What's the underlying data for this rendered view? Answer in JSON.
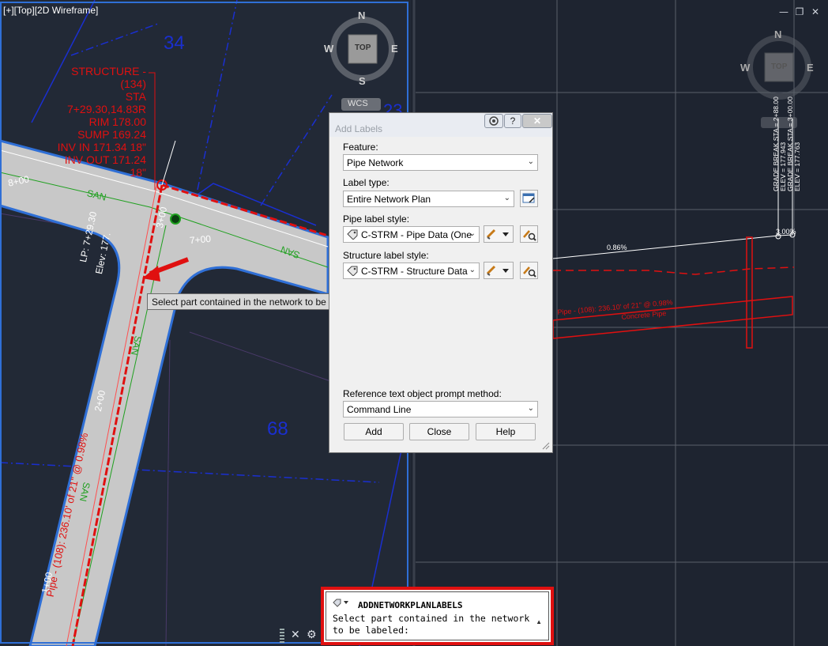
{
  "viewport": {
    "label": "[+][Top][2D Wireframe]"
  },
  "viewcube": {
    "left": {
      "n": "N",
      "s": "S",
      "e": "E",
      "w": "W",
      "face": "TOP",
      "ucs": "WCS"
    },
    "right": {
      "n": "N",
      "s": "S",
      "e": "E",
      "w": "W",
      "face": "TOP"
    }
  },
  "drawing": {
    "structure_label": [
      "STRUCTURE - (134)",
      "STA 7+29.30,14.83R",
      "RIM 178.00",
      "SUMP 169.24",
      "INV IN 171.34 18\"",
      "INV OUT 171.24 18\""
    ],
    "parcel_34": "34",
    "parcel_68": "68",
    "parcel_23": "23",
    "station_8": "8+00",
    "station_7": "7+00",
    "station_3": "3+00",
    "station_2": "2+00",
    "station_1": "1+00",
    "san": "SAN",
    "lp_label": "LP: 7+29.30",
    "elev_partial": "Elev: 177.",
    "pipe_label": "Pipe - (108): 236.10' of 21\" @ 0.98%",
    "profile_pipe_label": "Pipe - (108): 236.10' of 21\" @ 0.98%",
    "profile_pipe_material": "Concrete Pipe",
    "profile_grade": "0.86%",
    "profile_grade2": "3.00%",
    "profile_vert_1": "GRADE BREAK STA = 2+88.00",
    "profile_vert_2": "ELEV = 177.943",
    "profile_vert_3": "GRADE BREAK STA = 3+00.00",
    "profile_vert_4": "ELEV = 177.763"
  },
  "tooltip": {
    "text": "Select part contained in the network to be labeled:"
  },
  "dialog": {
    "title": "Add Labels",
    "help_icon": "?",
    "close_icon": "✕",
    "feature_label": "Feature:",
    "feature_value": "Pipe Network",
    "label_type_label": "Label type:",
    "label_type_value": "Entire Network Plan",
    "pipe_style_label": "Pipe label style:",
    "pipe_style_value": "C-STRM - Pipe Data (One",
    "structure_style_label": "Structure label style:",
    "structure_style_value": "C-STRM - Structure Data",
    "prompt_label": "Reference text object prompt method:",
    "prompt_value": "Command Line",
    "add_button": "Add",
    "close_button": "Close",
    "help_button": "Help"
  },
  "command_line": {
    "command": "ADDNETWORKPLANLABELS",
    "prompt": "Select part contained in the network to be labeled:"
  },
  "window_controls": {
    "minimize": "—",
    "restore": "❐",
    "close": "✕"
  },
  "colors": {
    "background": "#1e2430",
    "road": "#c8c8c8",
    "pipe": "#e01010",
    "parcel_line": "#1a2fd0",
    "alignment": "#1fa01f",
    "highlight": "#e01010"
  }
}
